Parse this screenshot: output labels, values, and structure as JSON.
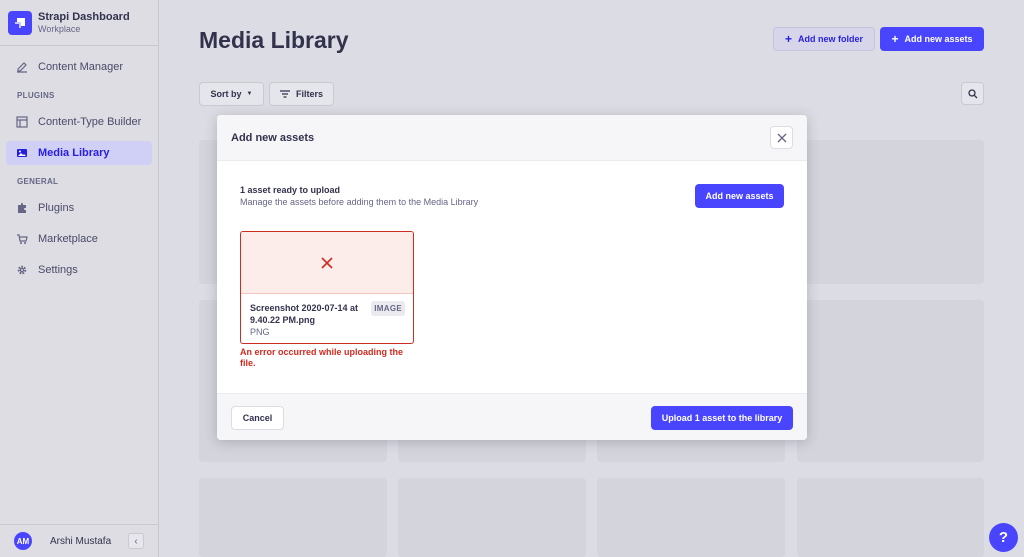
{
  "brand": {
    "title": "Strapi Dashboard",
    "subtitle": "Workplace"
  },
  "sidebar": {
    "items_top": [
      {
        "label": "Content Manager",
        "icon": "pencil-icon"
      }
    ],
    "plugins_title": "PLUGINS",
    "plugins": [
      {
        "label": "Content-Type Builder",
        "icon": "layout-icon"
      },
      {
        "label": "Media Library",
        "icon": "image-icon",
        "active": true
      }
    ],
    "general_title": "GENERAL",
    "general": [
      {
        "label": "Plugins",
        "icon": "puzzle-icon"
      },
      {
        "label": "Marketplace",
        "icon": "cart-icon"
      },
      {
        "label": "Settings",
        "icon": "gear-icon"
      }
    ]
  },
  "user": {
    "initials": "AM",
    "name": "Arshi Mustafa",
    "collapse_glyph": "‹"
  },
  "header": {
    "title": "Media Library",
    "add_folder_label": "Add new folder",
    "add_assets_label": "Add new assets"
  },
  "toolbar": {
    "sort_label": "Sort by",
    "filters_label": "Filters"
  },
  "modal": {
    "title": "Add new assets",
    "ready_title": "1 asset ready to upload",
    "ready_subtitle": "Manage the assets before adding them to the Media Library",
    "add_assets_label": "Add new assets",
    "asset": {
      "name": "Screenshot 2020-07-14 at 9.40.22 PM.png",
      "extension": "PNG",
      "badge": "IMAGE",
      "error": "An error occurred while uploading the file."
    },
    "cancel_label": "Cancel",
    "upload_label": "Upload 1 asset to the library"
  },
  "help": {
    "glyph": "?"
  },
  "colors": {
    "primary": "#4945ff",
    "error": "#d02b20",
    "overlay": "#dcdce4"
  }
}
